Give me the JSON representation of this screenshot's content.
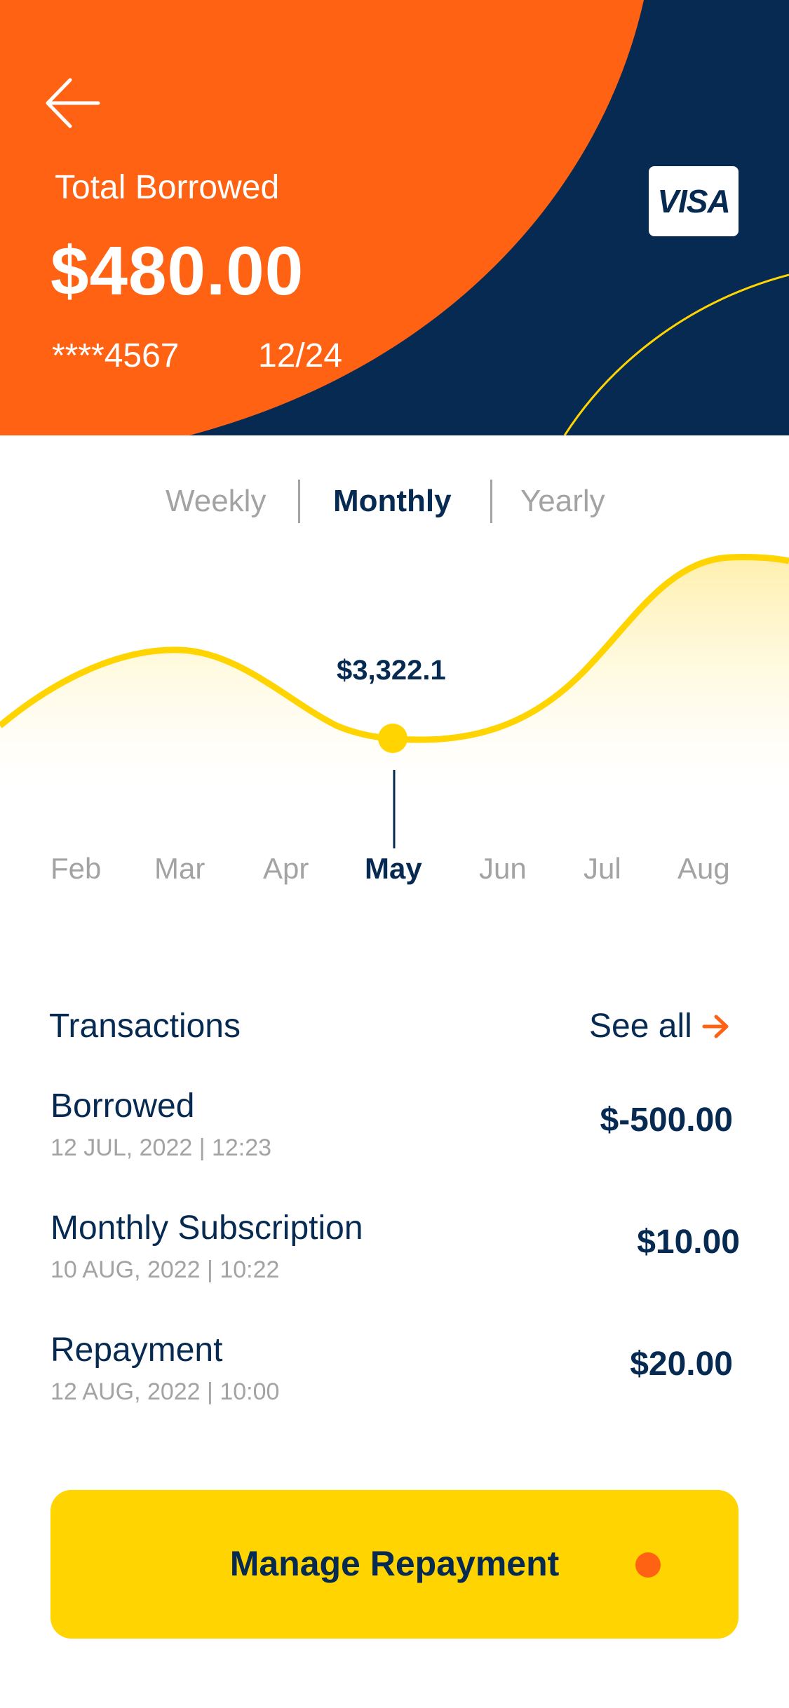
{
  "colors": {
    "orange": "#ff6213",
    "navy": "#072a52",
    "yellow": "#ffd400",
    "muted": "#a3a3a3"
  },
  "header": {
    "back_icon": "arrow-left-icon",
    "total_label": "Total Borrowed",
    "total_amount": "$480.00",
    "card_number": "****4567",
    "card_expiry": "12/24",
    "card_brand": "VISA"
  },
  "period_tabs": [
    {
      "label": "Weekly",
      "active": false
    },
    {
      "label": "Monthly",
      "active": true
    },
    {
      "label": "Yearly",
      "active": false
    }
  ],
  "chart_data": {
    "type": "area",
    "x": [
      "Feb",
      "Mar",
      "Apr",
      "May",
      "Jun",
      "Jul",
      "Aug"
    ],
    "selected": "May",
    "selected_value_label": "$3,322.1"
  },
  "transactions": {
    "title": "Transactions",
    "see_all": "See all",
    "items": [
      {
        "name": "Borrowed",
        "date": "12 JUL, 2022 | 12:23",
        "amount": "$-500.00"
      },
      {
        "name": "Monthly Subscription",
        "date": "10 AUG, 2022 | 10:22",
        "amount": "$10.00"
      },
      {
        "name": "Repayment",
        "date": "12 AUG, 2022 | 10:00",
        "amount": "$20.00"
      }
    ]
  },
  "cta": {
    "label": "Manage Repayment"
  }
}
